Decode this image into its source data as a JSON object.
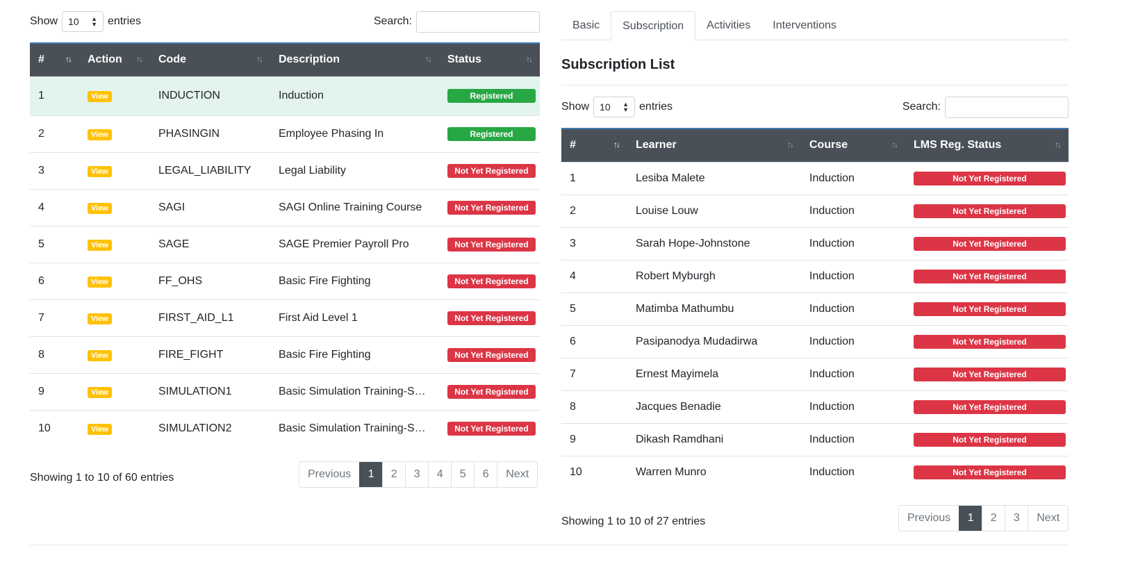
{
  "left": {
    "length_label_pre": "Show",
    "length_value": "10",
    "length_label_post": "entries",
    "search_label": "Search:",
    "search_value": "",
    "columns": [
      "#",
      "Action",
      "Code",
      "Description",
      "Status"
    ],
    "rows": [
      {
        "num": "1",
        "action": "View",
        "code": "INDUCTION",
        "description": "Induction",
        "status": "Registered"
      },
      {
        "num": "2",
        "action": "View",
        "code": "PHASINGIN",
        "description": "Employee Phasing In",
        "status": "Registered"
      },
      {
        "num": "3",
        "action": "View",
        "code": "LEGAL_LIABILITY",
        "description": "Legal Liability",
        "status": "Not Yet Registered"
      },
      {
        "num": "4",
        "action": "View",
        "code": "SAGI",
        "description": "SAGI Online Training Course",
        "status": "Not Yet Registered"
      },
      {
        "num": "5",
        "action": "View",
        "code": "SAGE",
        "description": "SAGE Premier Payroll Pro",
        "status": "Not Yet Registered"
      },
      {
        "num": "6",
        "action": "View",
        "code": "FF_OHS",
        "description": "Basic Fire Fighting",
        "status": "Not Yet Registered"
      },
      {
        "num": "7",
        "action": "View",
        "code": "FIRST_AID_L1",
        "description": "First Aid Level 1",
        "status": "Not Yet Registered"
      },
      {
        "num": "8",
        "action": "View",
        "code": "FIRE_FIGHT",
        "description": "Basic Fire Fighting",
        "status": "Not Yet Registered"
      },
      {
        "num": "9",
        "action": "View",
        "code": "SIMULATION1",
        "description": "Basic Simulation Training-Ses...",
        "status": "Not Yet Registered"
      },
      {
        "num": "10",
        "action": "View",
        "code": "SIMULATION2",
        "description": "Basic Simulation Training-Ses...",
        "status": "Not Yet Registered"
      }
    ],
    "info": "Showing 1 to 10 of 60 entries",
    "pagination": [
      "Previous",
      "1",
      "2",
      "3",
      "4",
      "5",
      "6",
      "Next"
    ],
    "active_page": "1"
  },
  "tabs": [
    {
      "label": "Basic",
      "active": false
    },
    {
      "label": "Subscription",
      "active": true
    },
    {
      "label": "Activities",
      "active": false
    },
    {
      "label": "Interventions",
      "active": false
    }
  ],
  "right": {
    "title": "Subscription List",
    "length_label_pre": "Show",
    "length_value": "10",
    "length_label_post": "entries",
    "search_label": "Search:",
    "search_value": "",
    "columns": [
      "#",
      "Learner",
      "Course",
      "LMS Reg. Status"
    ],
    "rows": [
      {
        "num": "1",
        "learner": "Lesiba Malete",
        "course": "Induction",
        "status": "Not Yet Registered"
      },
      {
        "num": "2",
        "learner": "Louise Louw",
        "course": "Induction",
        "status": "Not Yet Registered"
      },
      {
        "num": "3",
        "learner": "Sarah Hope-Johnstone",
        "course": "Induction",
        "status": "Not Yet Registered"
      },
      {
        "num": "4",
        "learner": "Robert Myburgh",
        "course": "Induction",
        "status": "Not Yet Registered"
      },
      {
        "num": "5",
        "learner": "Matimba Mathumbu",
        "course": "Induction",
        "status": "Not Yet Registered"
      },
      {
        "num": "6",
        "learner": "Pasipanodya Mudadirwa",
        "course": "Induction",
        "status": "Not Yet Registered"
      },
      {
        "num": "7",
        "learner": "Ernest Mayimela",
        "course": "Induction",
        "status": "Not Yet Registered"
      },
      {
        "num": "8",
        "learner": "Jacques Benadie",
        "course": "Induction",
        "status": "Not Yet Registered"
      },
      {
        "num": "9",
        "learner": "Dikash Ramdhani",
        "course": "Induction",
        "status": "Not Yet Registered"
      },
      {
        "num": "10",
        "learner": "Warren Munro",
        "course": "Induction",
        "status": "Not Yet Registered"
      }
    ],
    "info": "Showing 1 to 10 of 27 entries",
    "pagination": [
      "Previous",
      "1",
      "2",
      "3",
      "Next"
    ],
    "active_page": "1"
  },
  "colors": {
    "header_bg": "#495057",
    "registered": "#28a745",
    "not_registered": "#dc3545",
    "view_badge": "#ffc107",
    "highlight_row": "#e3f4ec"
  }
}
